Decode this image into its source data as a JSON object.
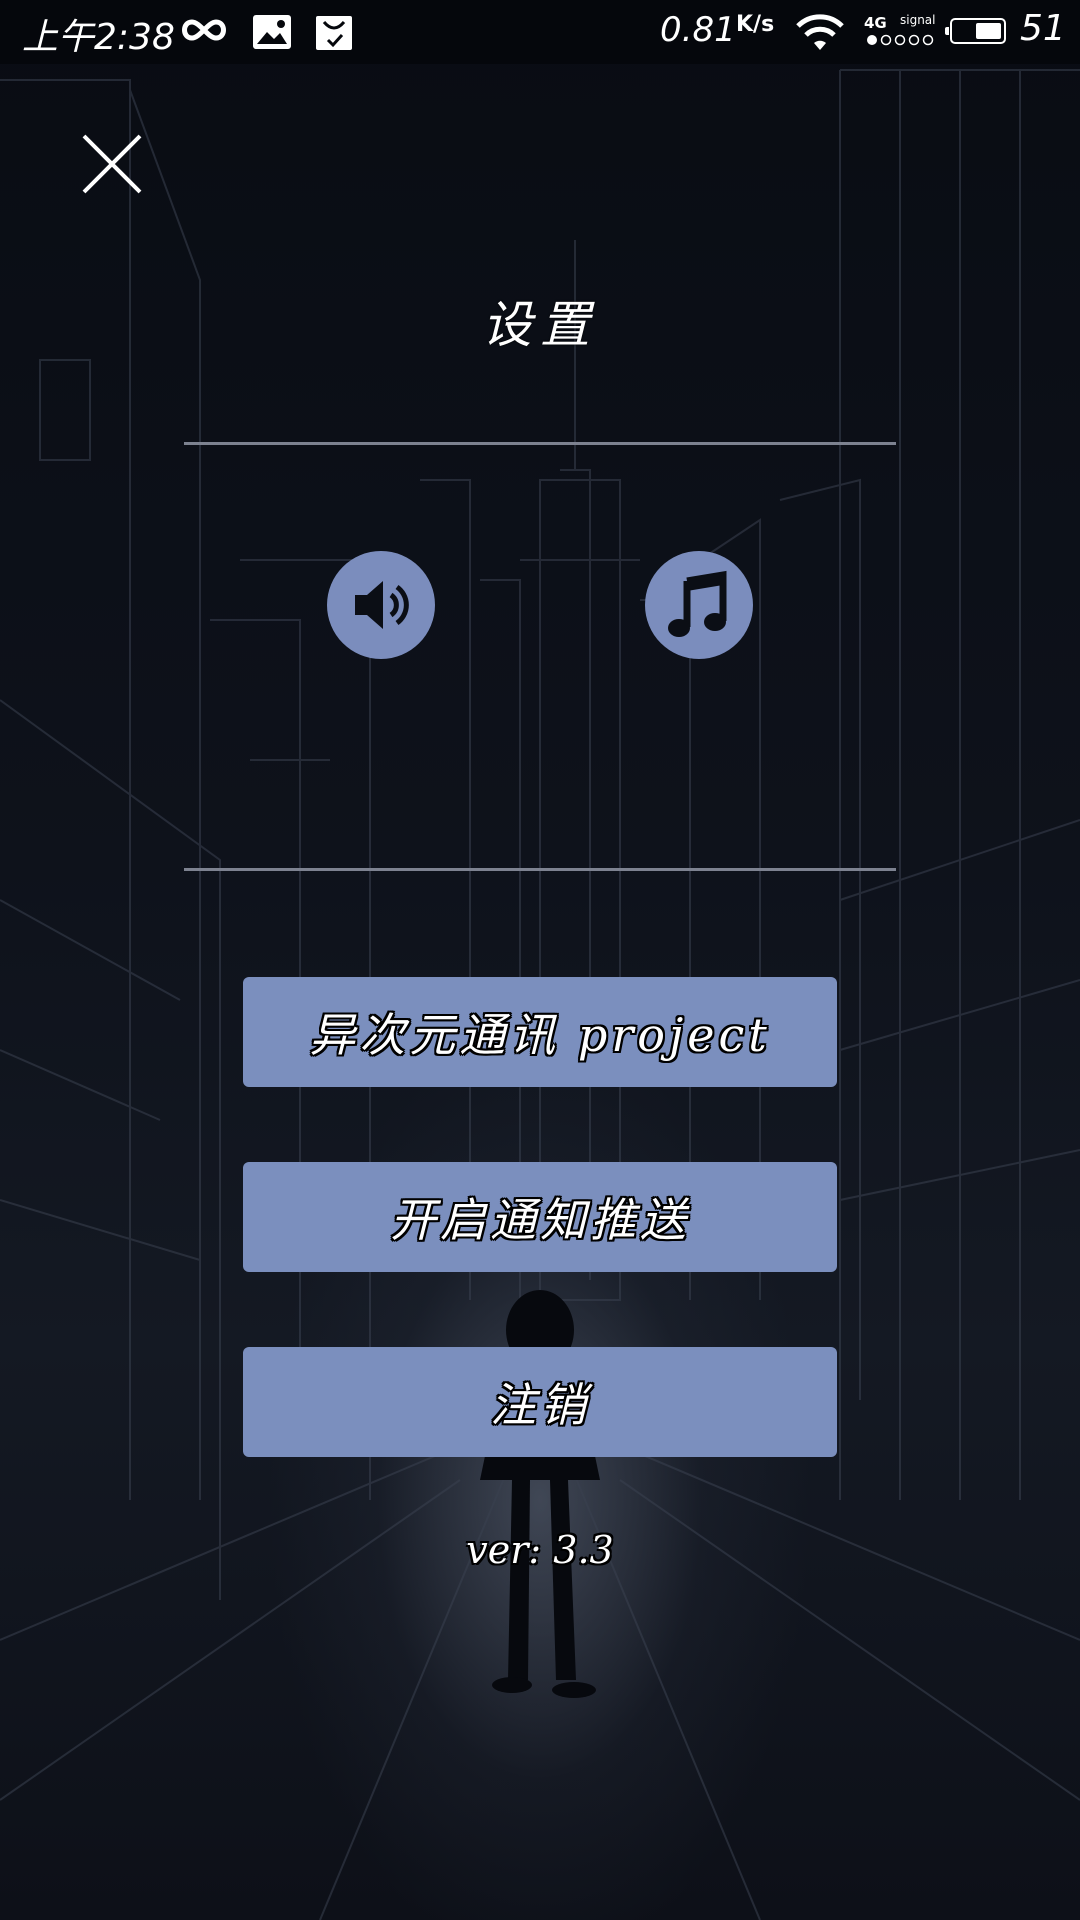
{
  "status_bar": {
    "time": "上午2:38",
    "net_speed": "0.81",
    "net_speed_unit": "K/s",
    "network_type": "4G",
    "signal_label": "signal",
    "battery_level": "51"
  },
  "settings": {
    "title": "设置",
    "sound_toggle_icon": "speaker-icon",
    "music_toggle_icon": "music-note-icon",
    "buttons": [
      {
        "label": "异次元通讯 project"
      },
      {
        "label": "开启通知推送"
      },
      {
        "label": "注销"
      }
    ],
    "version": "ver: 3.3"
  },
  "colors": {
    "button_fill": "#7b8fbe",
    "background": "#0b0e15",
    "divider": "#7d8290"
  }
}
